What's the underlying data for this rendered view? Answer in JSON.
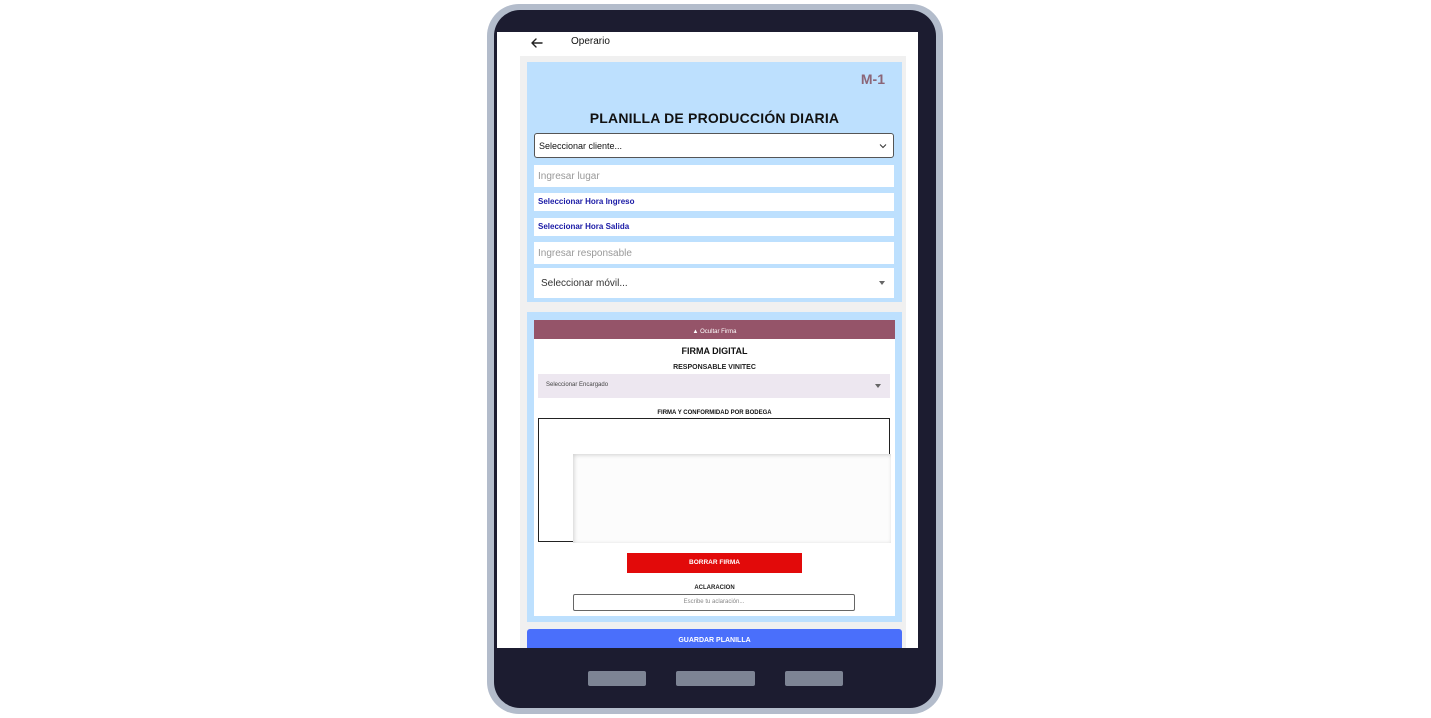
{
  "appbar": {
    "title": "Operario"
  },
  "form": {
    "code": "M-1",
    "title": "PLANILLA DE PRODUCCIÓN DIARIA",
    "client_select": "Seleccionar cliente...",
    "lugar_placeholder": "Ingresar lugar",
    "hora_ingreso": "Seleccionar Hora Ingreso",
    "hora_salida": "Seleccionar Hora Salida",
    "responsable_placeholder": "Ingresar responsable",
    "movil_select": "Seleccionar móvil..."
  },
  "signature": {
    "toggle_label": "▲ Ocultar Firma",
    "title": "FIRMA DIGITAL",
    "responsable_label": "RESPONSABLE VINITEC",
    "encargado_select": "Seleccionar Encargado",
    "conformidad_label": "FIRMA Y CONFORMIDAD POR BODEGA",
    "clear_button": "BORRAR FIRMA",
    "aclaracion_label": "ACLARACION",
    "aclaracion_placeholder": "Escribe tu aclaración..."
  },
  "actions": {
    "save_button": "GUARDAR PLANILLA"
  },
  "colors": {
    "card_bg": "#bde0fe",
    "toggle_bar": "#955469",
    "clear_button": "#e20a0a",
    "save_button": "#4a6ffb",
    "hora_text": "#1a1aa6"
  }
}
